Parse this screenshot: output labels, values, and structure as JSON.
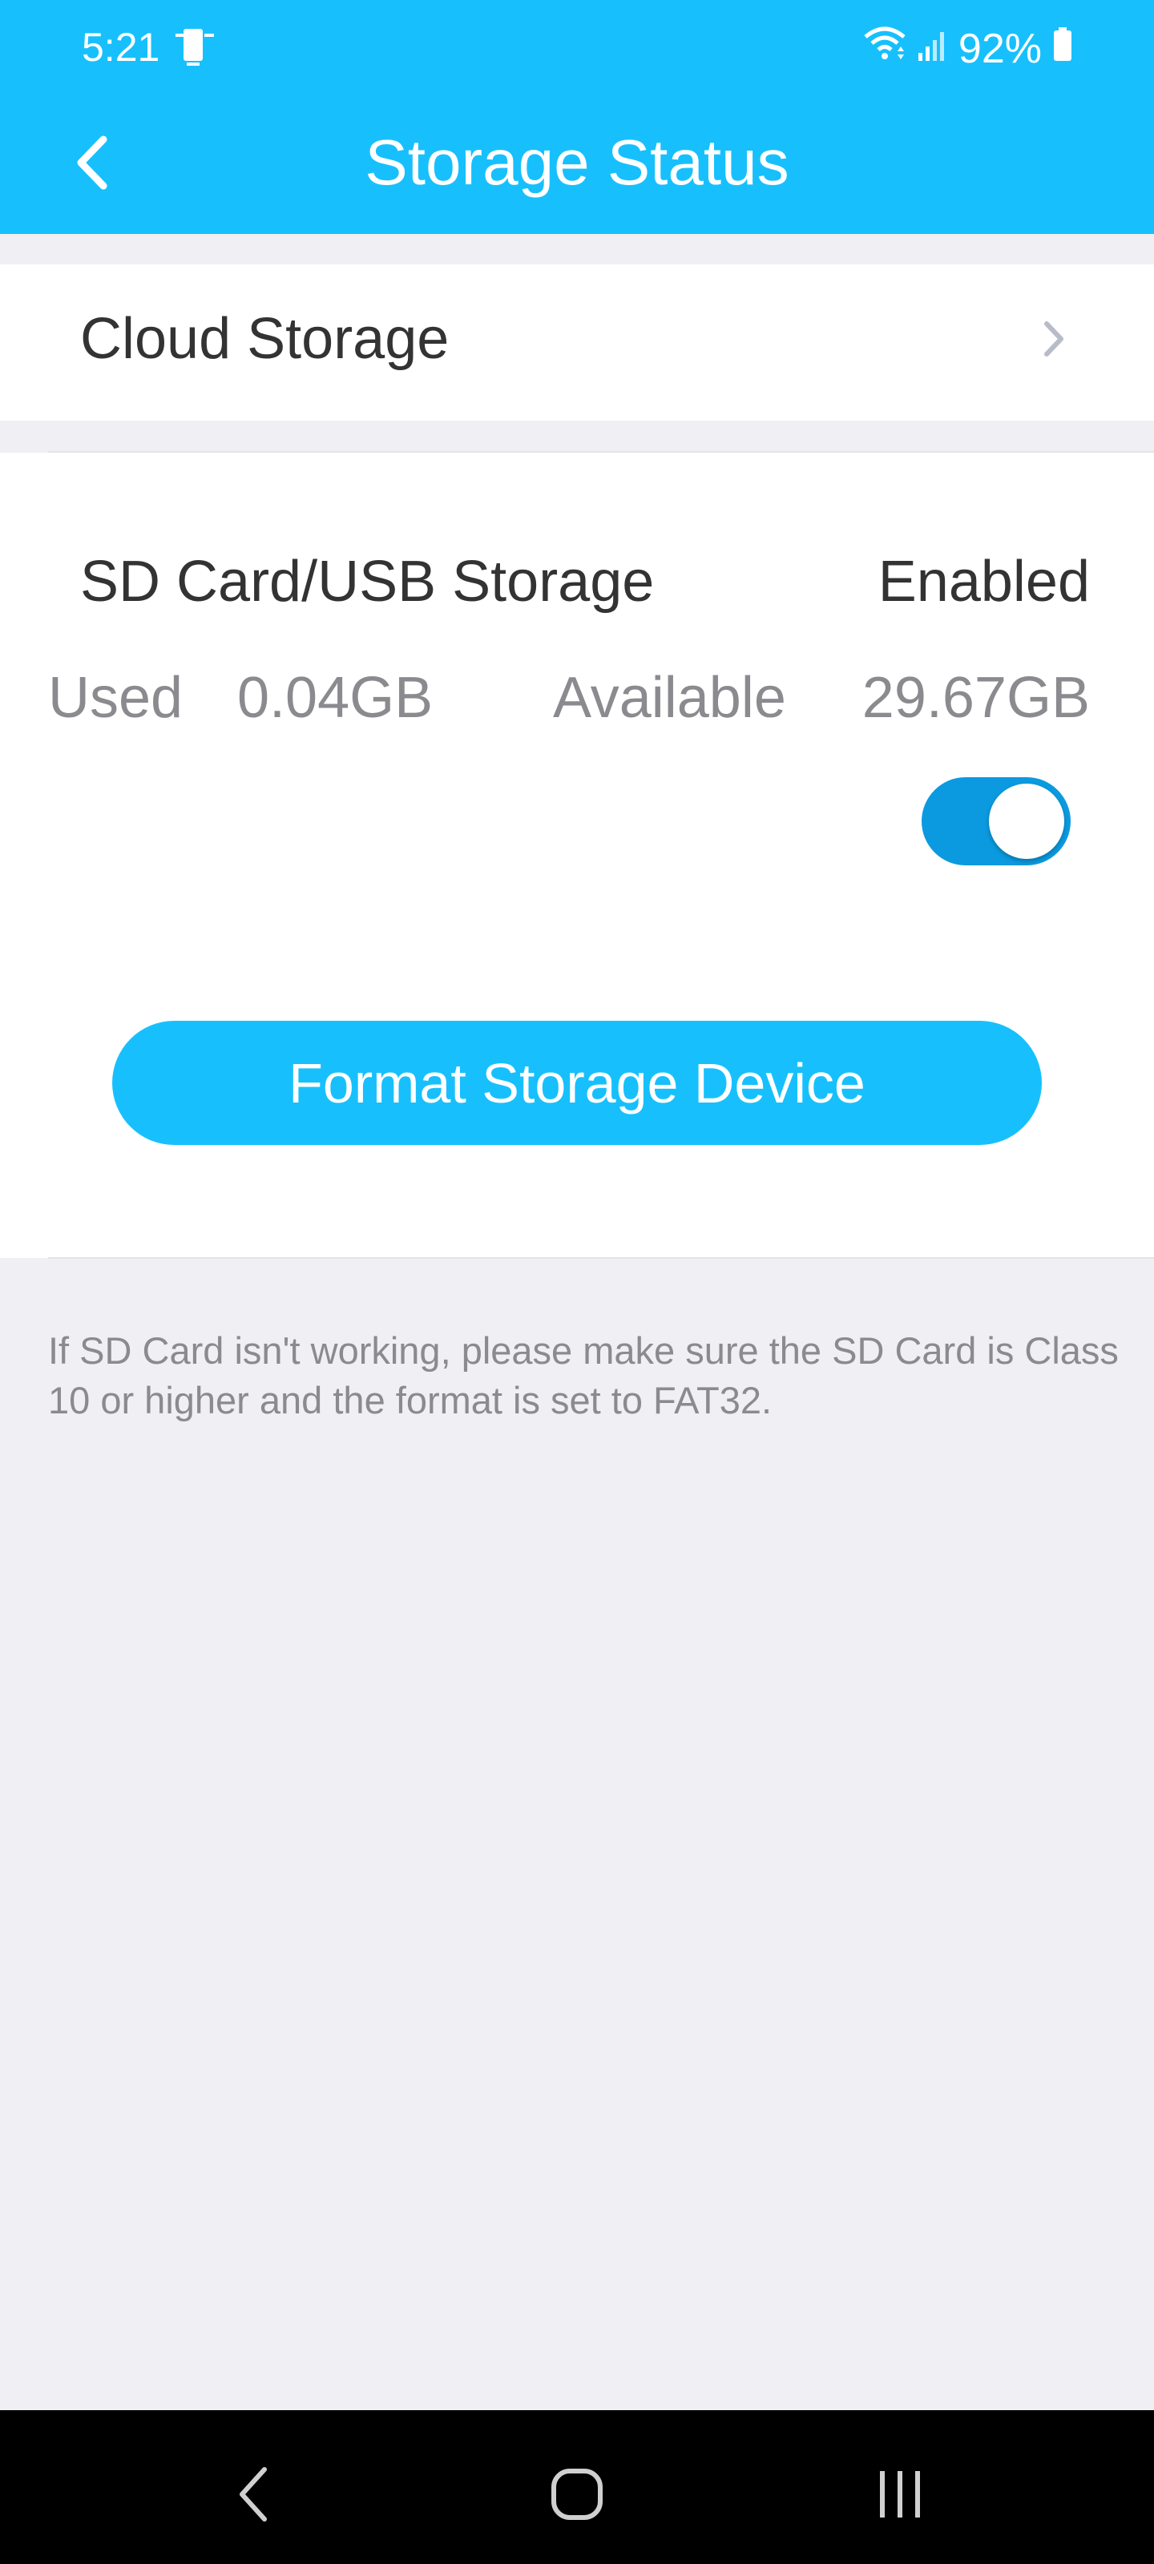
{
  "status_bar": {
    "time": "5:21",
    "battery": "92%"
  },
  "app_bar": {
    "title": "Storage Status"
  },
  "cloud": {
    "label": "Cloud Storage"
  },
  "sd_card": {
    "title": "SD Card/USB Storage",
    "status": "Enabled",
    "used_label": "Used",
    "used_value": "0.04GB",
    "available_label": "Available",
    "available_value": "29.67GB",
    "toggle_on": true
  },
  "actions": {
    "format_button": "Format Storage Device"
  },
  "note": {
    "text": "If SD Card isn't working, please make sure the SD Card is Class 10 or higher and the format is set to FAT32."
  },
  "colors": {
    "accent": "#17c0fd",
    "toggle_on": "#0b9ae0",
    "background": "#efeff4",
    "text_primary": "#333333",
    "text_secondary": "#8a8a8f"
  },
  "icons": {
    "status_left": "device-sync-icon",
    "wifi": "wifi-icon",
    "signal": "signal-icon",
    "battery": "battery-icon",
    "back": "back-arrow-icon",
    "chevron": "chevron-right-icon",
    "nav_back": "nav-back-icon",
    "nav_home": "nav-home-icon",
    "nav_recent": "nav-recent-apps-icon"
  }
}
